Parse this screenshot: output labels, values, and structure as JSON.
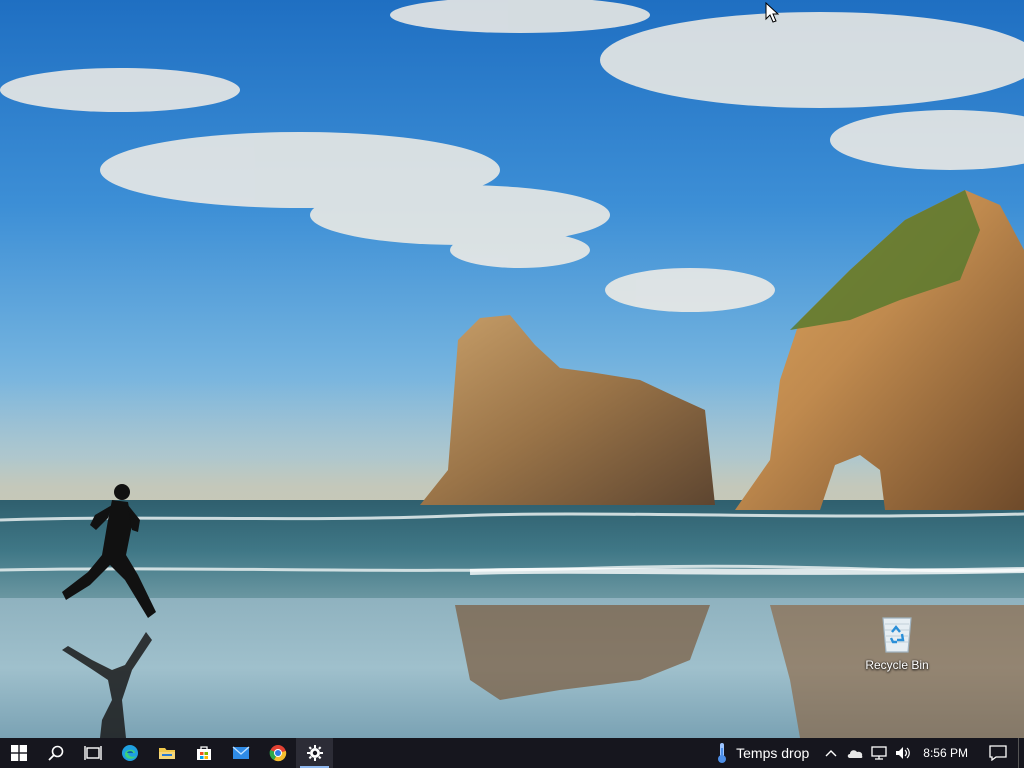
{
  "desktop": {
    "icons": [
      {
        "label": "Recycle Bin",
        "icon": "recycle-bin-icon"
      }
    ]
  },
  "taskbar": {
    "apps": [
      {
        "name": "start",
        "icon": "windows-logo-icon",
        "color": "#ffffff"
      },
      {
        "name": "search",
        "icon": "search-icon",
        "color": "#ffffff"
      },
      {
        "name": "task-view",
        "icon": "task-view-icon",
        "color": "#ffffff"
      },
      {
        "name": "edge",
        "icon": "edge-icon",
        "color": "#1fa0e0"
      },
      {
        "name": "file-explorer",
        "icon": "folder-icon",
        "color": "#f2c94c"
      },
      {
        "name": "store",
        "icon": "store-icon",
        "color": "#ffffff"
      },
      {
        "name": "mail",
        "icon": "mail-icon",
        "color": "#2f8be6"
      },
      {
        "name": "chrome",
        "icon": "chrome-icon",
        "color": "#e34133"
      },
      {
        "name": "settings",
        "icon": "gear-icon",
        "color": "#ffffff",
        "active": true
      }
    ],
    "tray": {
      "weather_text": "Temps drop",
      "clock": "8:56 PM"
    }
  }
}
